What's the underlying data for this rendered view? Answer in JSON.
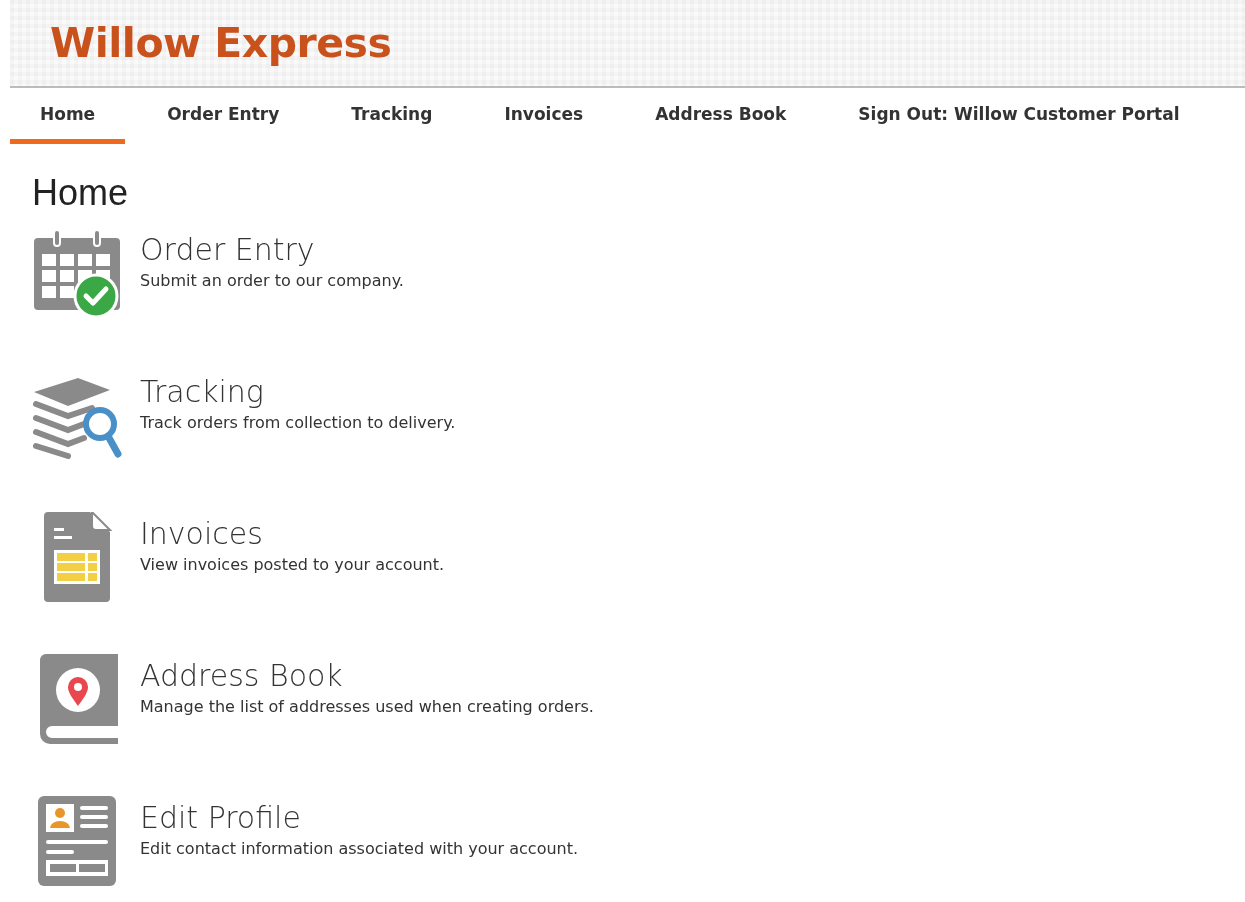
{
  "header": {
    "brand": "Willow Express"
  },
  "tabs": [
    {
      "label": "Home",
      "selected": true
    },
    {
      "label": "Order Entry",
      "selected": false
    },
    {
      "label": "Tracking",
      "selected": false
    },
    {
      "label": "Invoices",
      "selected": false
    },
    {
      "label": "Address Book",
      "selected": false
    },
    {
      "label": "Sign Out: Willow Customer Portal",
      "selected": false
    }
  ],
  "page_title": "Home",
  "items": [
    {
      "kind": "calendar",
      "title": "Order Entry",
      "description": "Submit an order to our company."
    },
    {
      "kind": "tracking",
      "title": "Tracking",
      "description": "Track orders from collection to delivery."
    },
    {
      "kind": "invoice",
      "title": "Invoices",
      "description": "View invoices posted to your account."
    },
    {
      "kind": "address",
      "title": "Address Book",
      "description": "Manage the list of addresses used when creating orders."
    },
    {
      "kind": "profile",
      "title": "Edit Profile",
      "description": "Edit contact information associated with your account."
    }
  ]
}
